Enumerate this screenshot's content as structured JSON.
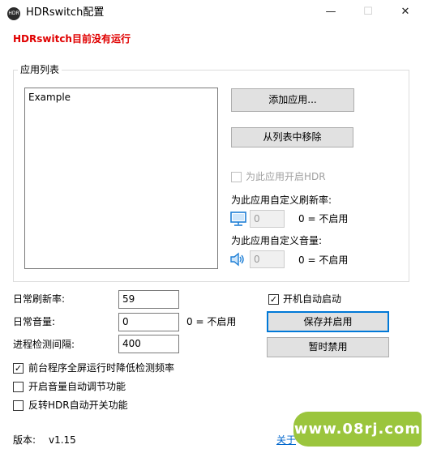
{
  "window": {
    "title": "HDRswitch配置",
    "app_icon_text": "HDR",
    "minimize": "—",
    "maximize": "☐",
    "close": "✕"
  },
  "status": {
    "text": "HDRswitch目前没有运行",
    "color": "#e00000"
  },
  "app_list": {
    "group_label": "应用列表",
    "items": [
      "Example"
    ],
    "add_button": "添加应用...",
    "remove_button": "从列表中移除",
    "enable_hdr_label": "为此应用开启HDR",
    "enable_hdr_checked": false,
    "refresh_rate_label": "为此应用自定义刷新率:",
    "refresh_rate_value": "0",
    "refresh_rate_hint": "0 = 不启用",
    "volume_label": "为此应用自定义音量:",
    "volume_value": "0",
    "volume_hint": "0 = 不启用"
  },
  "settings": {
    "daily_refresh_label": "日常刷新率:",
    "daily_refresh_value": "59",
    "daily_volume_label": "日常音量:",
    "daily_volume_value": "0",
    "daily_volume_hint": "0 = 不启用",
    "interval_label": "进程检测间隔:",
    "interval_value": "400"
  },
  "options": [
    {
      "label": "前台程序全屏运行时降低检测频率",
      "checked": true
    },
    {
      "label": "开启音量自动调节功能",
      "checked": false
    },
    {
      "label": "反转HDR自动开关功能",
      "checked": false
    }
  ],
  "startup": {
    "label": "开机自动启动",
    "checked": true
  },
  "actions": {
    "save_button": "保存并启用",
    "disable_button": "暂时禁用"
  },
  "footer": {
    "version_label": "版本:",
    "version_value": "v1.15",
    "about_link": "关于"
  },
  "watermark": {
    "text": "www.08rj.com"
  },
  "colors": {
    "accent": "#0078d7",
    "status_red": "#e00000",
    "link": "#0066cc",
    "icon_blue": "#1e7fd6"
  },
  "checkmark": "✓"
}
